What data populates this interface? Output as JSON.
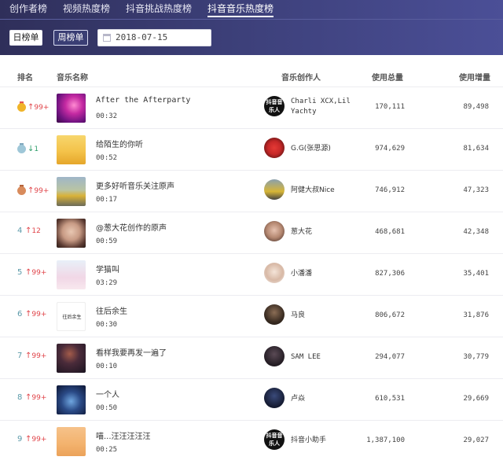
{
  "tabs": [
    {
      "label": "创作者榜"
    },
    {
      "label": "视频热度榜"
    },
    {
      "label": "抖音挑战热度榜"
    },
    {
      "label": "抖音音乐热度榜",
      "active": true
    }
  ],
  "filters": {
    "daily_label": "日榜单",
    "weekly_label": "周榜单",
    "date": "2018-07-15"
  },
  "table": {
    "headers": {
      "rank": "排名",
      "music": "音乐名称",
      "creator": "音乐创作人",
      "total": "使用总量",
      "increase": "使用增量"
    },
    "rows": [
      {
        "rank": "1",
        "change": "99+",
        "dir": "up",
        "medal": "gold",
        "title": "After the Afterparty",
        "duration": "00:32",
        "creator": "Charli XCX,Lil Yachty",
        "total": "170,111",
        "increase": "89,498",
        "avatar_text": "抖音音乐人"
      },
      {
        "rank": "2",
        "change": "1",
        "dir": "down",
        "medal": "silver",
        "title": "给陌生的你听",
        "duration": "00:52",
        "creator": "G.G(张思源)",
        "total": "974,629",
        "increase": "81,634",
        "avatar_text": ""
      },
      {
        "rank": "3",
        "change": "99+",
        "dir": "up",
        "medal": "bronze",
        "title": "更多好听音乐关注原声",
        "duration": "00:17",
        "creator": "阿健大叔Nice",
        "total": "746,912",
        "increase": "47,323",
        "avatar_text": ""
      },
      {
        "rank": "4",
        "change": "12",
        "dir": "up",
        "medal": "",
        "title": "@葱大花创作的原声",
        "duration": "00:59",
        "creator": "葱大花",
        "total": "468,681",
        "increase": "42,348",
        "avatar_text": ""
      },
      {
        "rank": "5",
        "change": "99+",
        "dir": "up",
        "medal": "",
        "title": "学猫叫",
        "duration": "03:29",
        "creator": "小潘潘",
        "total": "827,306",
        "increase": "35,401",
        "avatar_text": ""
      },
      {
        "rank": "6",
        "change": "99+",
        "dir": "up",
        "medal": "",
        "title": "往后余生",
        "duration": "00:30",
        "creator": "马良",
        "total": "806,672",
        "increase": "31,876",
        "avatar_text": "",
        "cover_text": "往后余生"
      },
      {
        "rank": "7",
        "change": "99+",
        "dir": "up",
        "medal": "",
        "title": "看样我要再发一遍了",
        "duration": "00:10",
        "creator": "SAM LEE",
        "total": "294,077",
        "increase": "30,779",
        "avatar_text": ""
      },
      {
        "rank": "8",
        "change": "99+",
        "dir": "up",
        "medal": "",
        "title": "一个人",
        "duration": "00:50",
        "creator": "卢焱",
        "total": "610,531",
        "increase": "29,669",
        "avatar_text": ""
      },
      {
        "rank": "9",
        "change": "99+",
        "dir": "up",
        "medal": "",
        "title": "喵...汪汪汪汪汪",
        "duration": "00:25",
        "creator": "抖音小助手",
        "total": "1,387,100",
        "increase": "29,027",
        "avatar_text": "抖音音乐人"
      }
    ]
  },
  "colors": {
    "header_start": "#2f2f5a",
    "header_end": "#4b4f97",
    "up": "#e0454a",
    "down": "#2f9e6a",
    "rank_text": "#5b9aa9"
  }
}
